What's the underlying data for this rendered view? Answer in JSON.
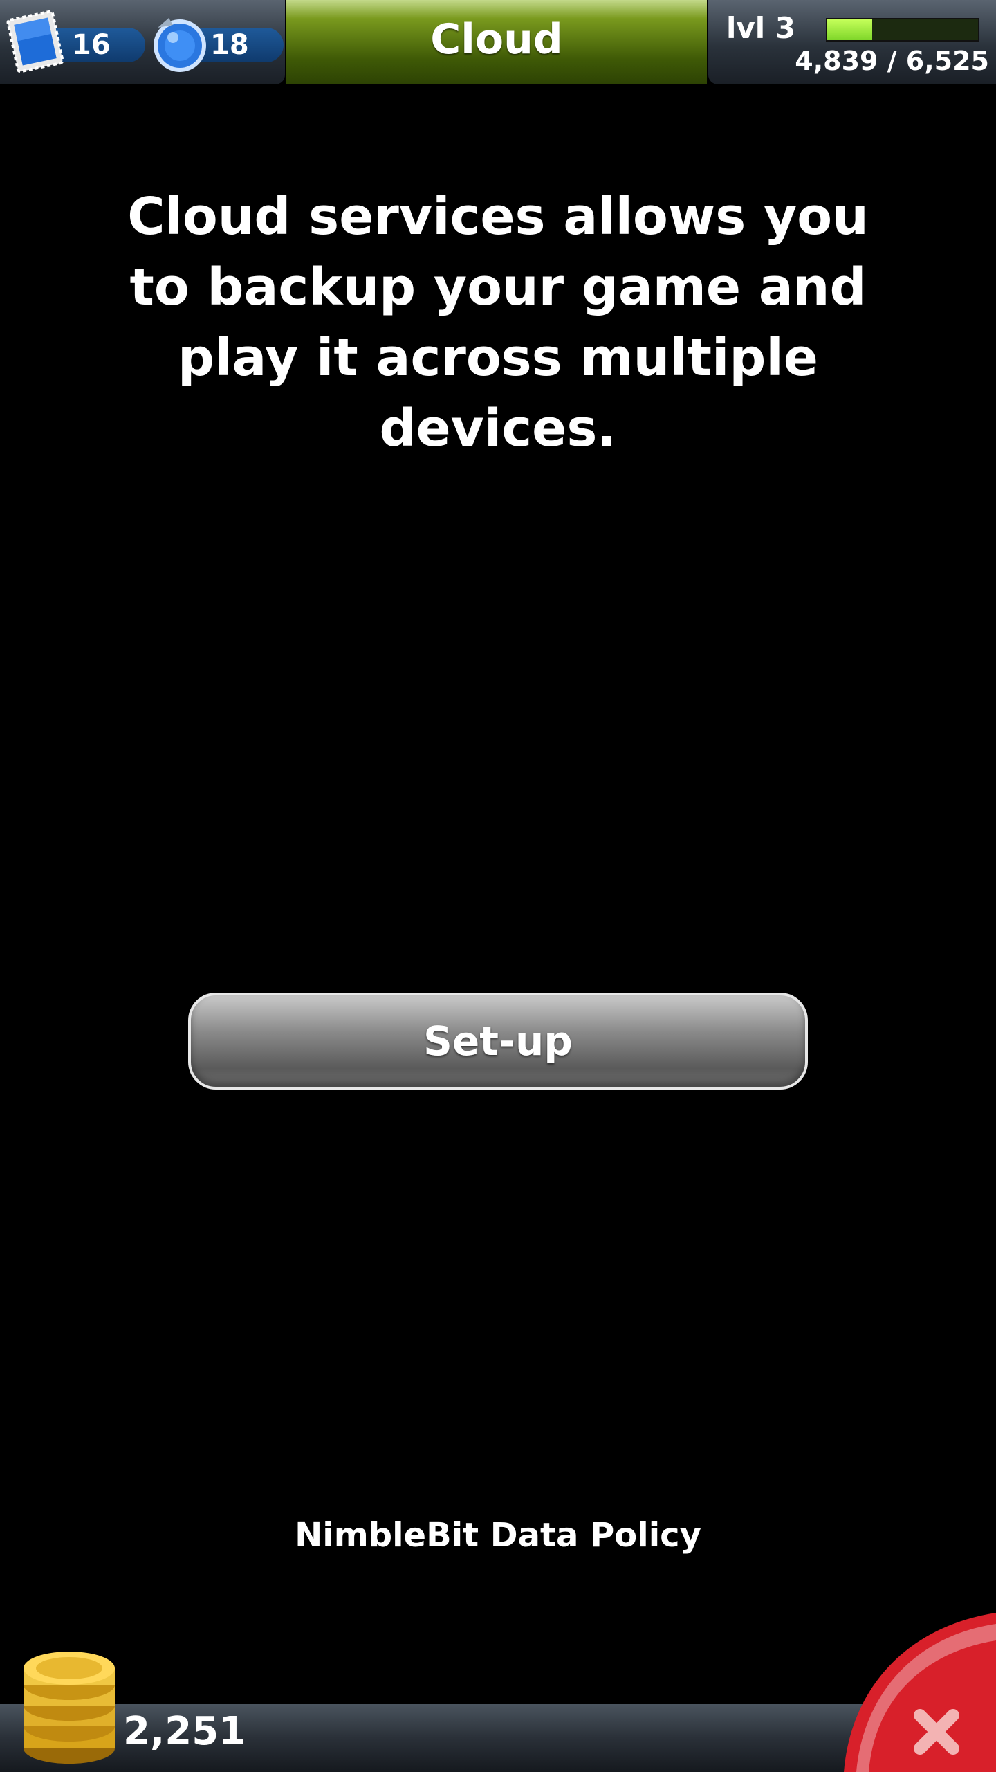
{
  "header": {
    "title": "Cloud",
    "stamps_count": "16",
    "bux_count": "18",
    "level_label": "lvl 3",
    "xp_text": "4,839 / 6,525",
    "xp_progress": 0.3,
    "accent_green": "#7a9a1e",
    "xp_bar_color": "#9be03c"
  },
  "main": {
    "message": "Cloud services allows you to backup your game and play it across multiple devices.",
    "setup_button_label": "Set-up",
    "policy_link": "NimbleBit Data Policy"
  },
  "footer": {
    "coins_count": "2,251",
    "close_button_color": "#d8202a"
  },
  "icons": {
    "stamps": "stamp-icon",
    "bux": "bux-icon",
    "coins": "coins-icon",
    "close": "close-icon"
  }
}
